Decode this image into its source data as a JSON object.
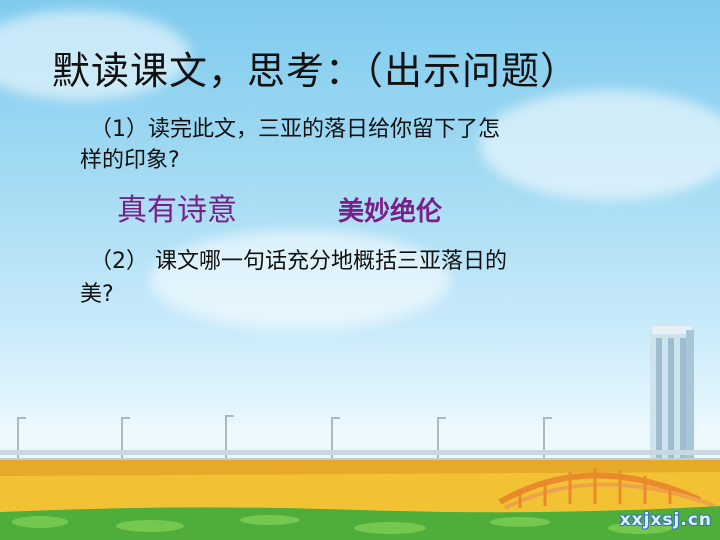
{
  "slide": {
    "title": "默读课文，思考：（出示问题）",
    "question1": {
      "line1": "（1）读完此文，三亚的落日给你留下了怎",
      "line2": "样的印象?"
    },
    "answers": {
      "answer1": "真有诗意",
      "answer2": "美妙绝伦"
    },
    "question2": {
      "line1": "（2） 课文哪一句话充分地概括三亚落日的",
      "line2": "美?"
    },
    "watermark": "xxjxsj.cn"
  },
  "colors": {
    "sky_top": "#7fcbee",
    "answer_text": "#7a1f8a",
    "ground": "#f2c234",
    "grass": "#4fae3a",
    "bridge": "#e98b2a"
  }
}
